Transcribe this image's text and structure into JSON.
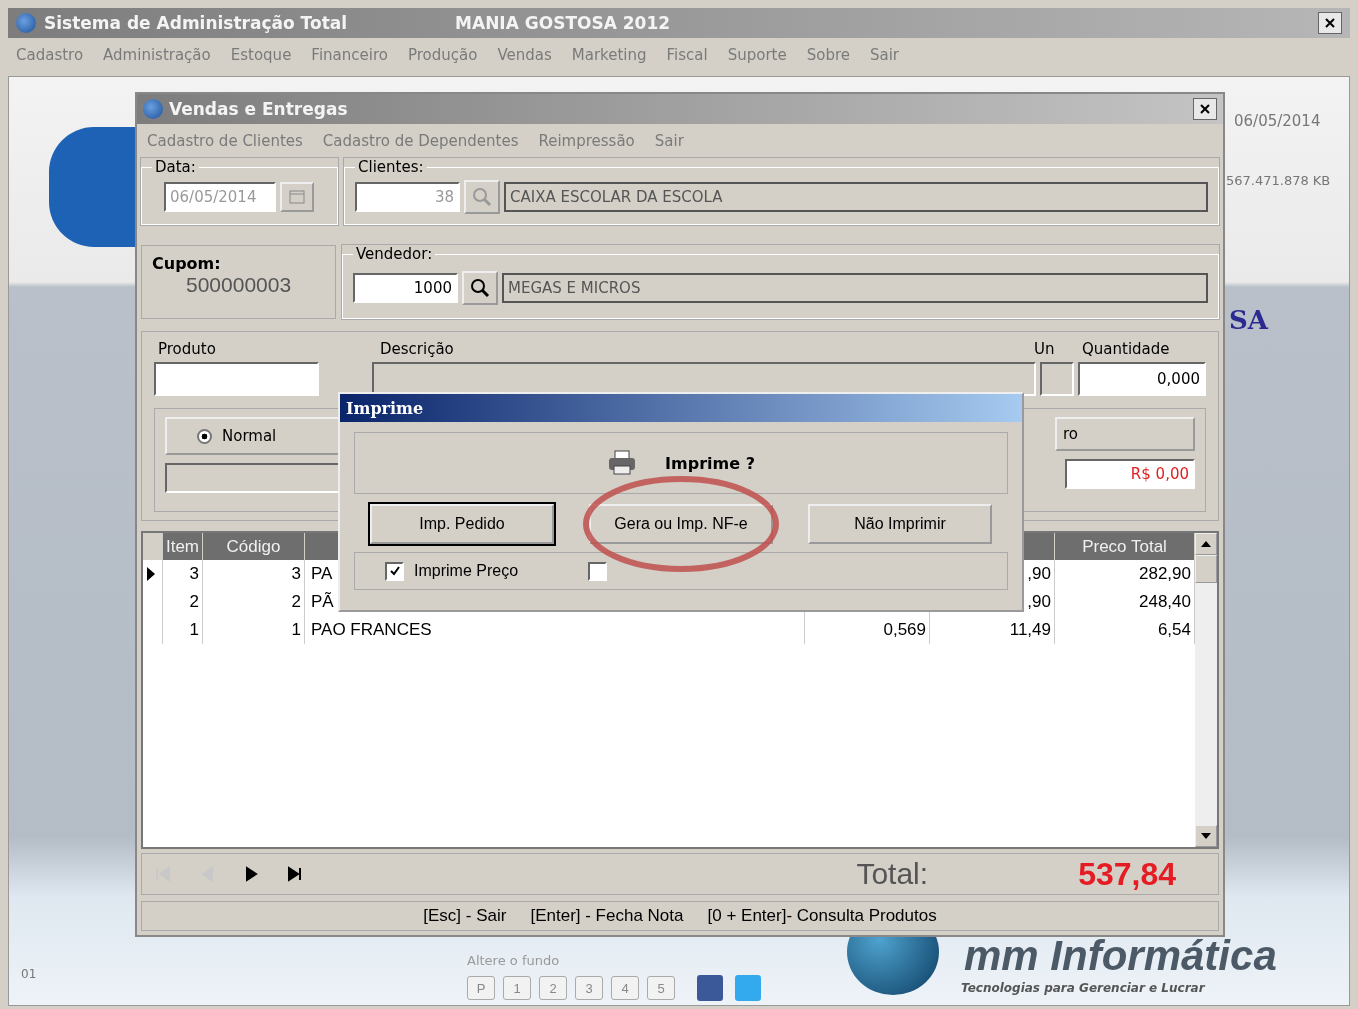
{
  "app": {
    "title": "Sistema de Administração Total",
    "company": "MANIA GOSTOSA 2012",
    "menu": [
      "Cadastro",
      "Administração",
      "Estoque",
      "Financeiro",
      "Produção",
      "Vendas",
      "Marketing",
      "Fiscal",
      "Suporte",
      "Sobre",
      "Sair"
    ]
  },
  "desktop": {
    "date": "06/05/2014",
    "disk": "567.471.878 KB",
    "brand_fragment": "SA",
    "corner_text": "01",
    "background_label": "Altere o fundo",
    "background_buttons": [
      "P",
      "1",
      "2",
      "3",
      "4",
      "5"
    ],
    "logo_name": "mm Informática",
    "logo_tagline": "Tecnologias para Gerenciar e Lucrar"
  },
  "sales_window": {
    "title": "Vendas e Entregas",
    "menu": [
      "Cadastro de Clientes",
      "Cadastro de Dependentes",
      "Reimpressão",
      "Sair"
    ],
    "date": {
      "label": "Data:",
      "value": "06/05/2014"
    },
    "client": {
      "label": "Clientes:",
      "code": "38",
      "name": "CAIXA ESCOLAR DA ESCOLA"
    },
    "coupon": {
      "label": "Cupom:",
      "value": "500000003"
    },
    "seller": {
      "label": "Vendedor:",
      "code": "1000",
      "name": "MEGAS E MICROS"
    },
    "product": {
      "product_label": "Produto",
      "description_label": "Descrição",
      "unit_label": "Un",
      "quantity_label": "Quantidade",
      "quantity": "0,000"
    },
    "mode": {
      "label": "Normal",
      "selected": true
    },
    "hidden_button_fragment": "ro",
    "price": "R$ 0,00",
    "table": {
      "columns": {
        "item": "Item",
        "code": "Código",
        "total": "Preco Total"
      },
      "rows": [
        {
          "current": true,
          "item": "3",
          "code": "3",
          "description": "PA",
          "column_5": ",90",
          "total": "282,90"
        },
        {
          "current": false,
          "item": "2",
          "code": "2",
          "description": "PÃ",
          "column_5": ",90",
          "total": "248,40"
        },
        {
          "current": false,
          "item": "1",
          "code": "1",
          "description": "PAO FRANCES",
          "column_4": "0,569",
          "column_5": "11,49",
          "total": "6,54"
        }
      ]
    },
    "nav": [
      {
        "kind": "first",
        "disabled": true
      },
      {
        "kind": "prev",
        "disabled": true
      },
      {
        "kind": "next",
        "disabled": false
      },
      {
        "kind": "last",
        "disabled": false
      }
    ],
    "total": {
      "label": "Total:",
      "value": "537,84"
    },
    "shortcuts": [
      "[Esc] - Sair",
      "[Enter] - Fecha Nota",
      "[0 + Enter]- Consulta Produtos"
    ]
  },
  "print_dialog": {
    "title": "Imprime",
    "question": "Imprime ?",
    "buttons": [
      {
        "label": "Imp. Pedido",
        "focused": true,
        "highlighted": false
      },
      {
        "label": "Gera ou Imp. NF-e",
        "focused": false,
        "highlighted": true
      },
      {
        "label": "Não Imprimir",
        "focused": false,
        "highlighted": false
      }
    ],
    "options": [
      {
        "label": "Imprime Preço",
        "checked": true
      },
      {
        "checked": false
      }
    ]
  }
}
